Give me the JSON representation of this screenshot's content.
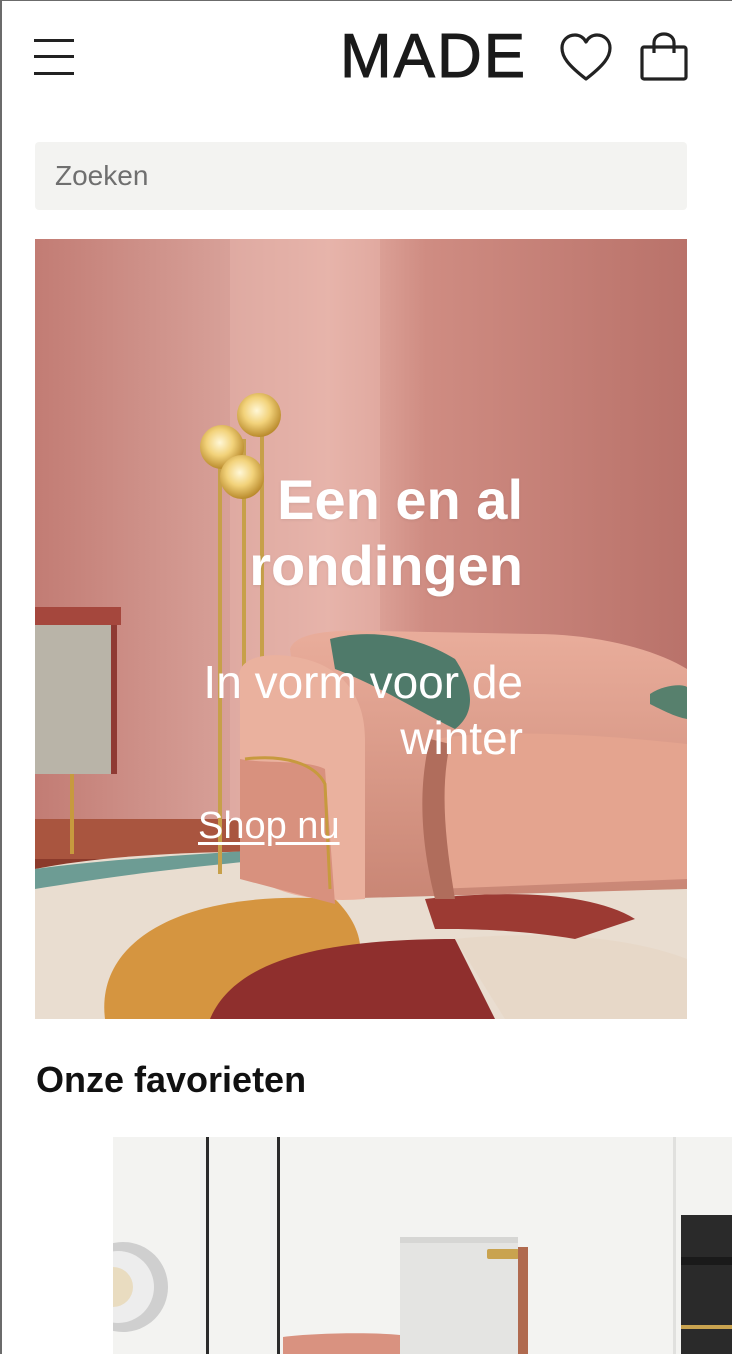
{
  "header": {
    "logo_text": "MADE",
    "menu_icon": "hamburger-menu-icon",
    "wishlist_icon": "heart-icon",
    "bag_icon": "shopping-bag-icon"
  },
  "search": {
    "placeholder": "Zoeken"
  },
  "hero": {
    "title": "Een en al rondingen",
    "subtitle": "In vorm voor de winter",
    "cta_label": "Shop nu"
  },
  "favorites": {
    "title": "Onze favorieten"
  },
  "colors": {
    "brand_text": "#1a1a1a",
    "search_bg": "#f3f3f1",
    "hero_wall": "#c98880"
  }
}
